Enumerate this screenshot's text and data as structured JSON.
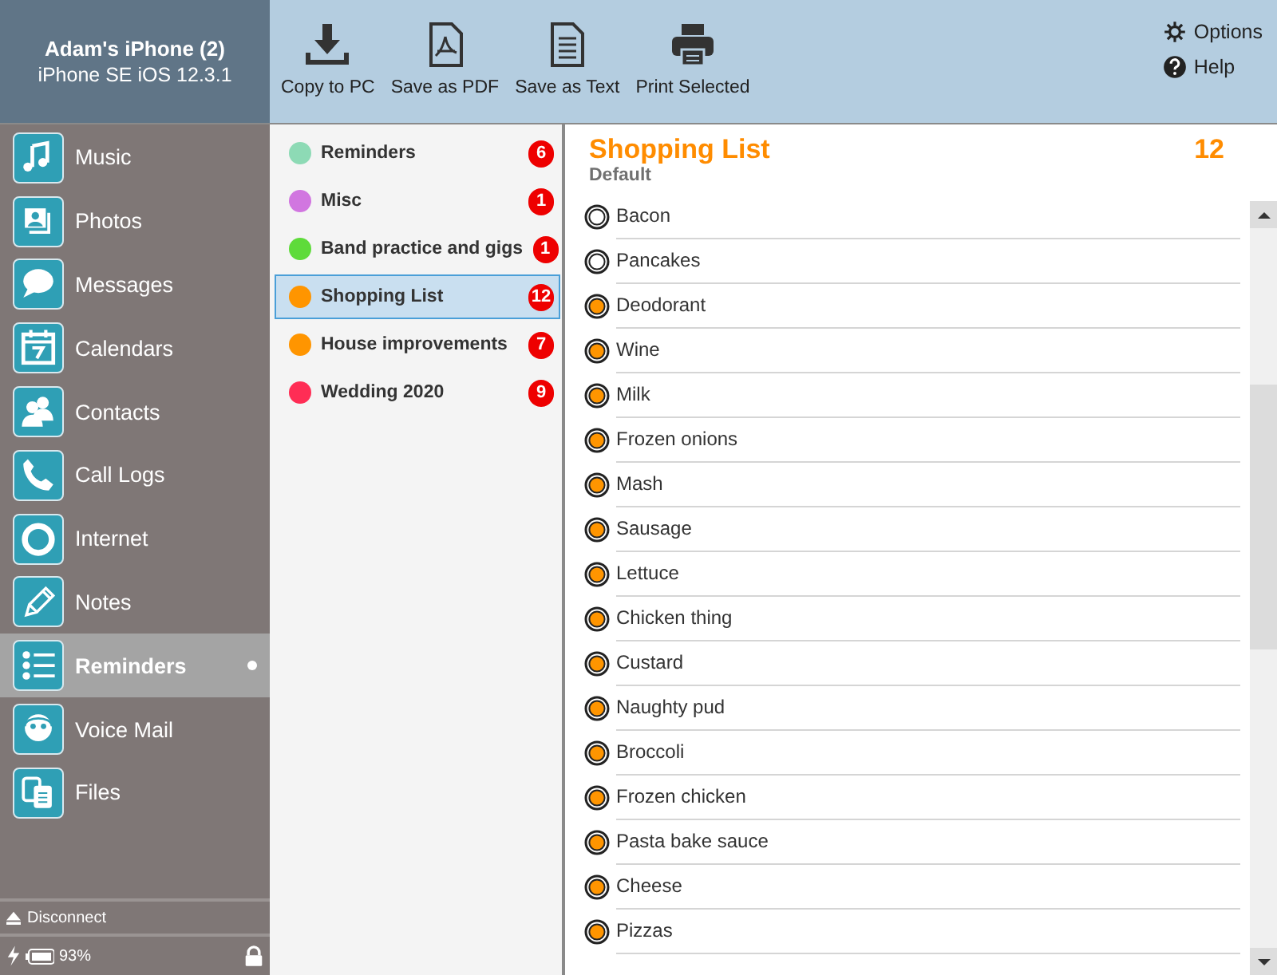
{
  "device": {
    "name": "Adam's iPhone (2)",
    "model": "iPhone SE iOS 12.3.1"
  },
  "toolbar": [
    {
      "kind": "download",
      "label": "Copy to PC"
    },
    {
      "kind": "pdf",
      "label": "Save as PDF"
    },
    {
      "kind": "text",
      "label": "Save as Text"
    },
    {
      "kind": "print",
      "label": "Print Selected"
    }
  ],
  "options": [
    {
      "kind": "gear",
      "label": "Options"
    },
    {
      "kind": "help",
      "label": "Help"
    }
  ],
  "sidebar": {
    "items": [
      {
        "kind": "music",
        "label": "Music",
        "selected": false
      },
      {
        "kind": "photos",
        "label": "Photos",
        "selected": false
      },
      {
        "kind": "messages",
        "label": "Messages",
        "selected": false
      },
      {
        "kind": "calendars",
        "label": "Calendars",
        "selected": false
      },
      {
        "kind": "contacts",
        "label": "Contacts",
        "selected": false
      },
      {
        "kind": "calls",
        "label": "Call Logs",
        "selected": false
      },
      {
        "kind": "internet",
        "label": "Internet",
        "selected": false
      },
      {
        "kind": "notes",
        "label": "Notes",
        "selected": false
      },
      {
        "kind": "reminders",
        "label": "Reminders",
        "selected": true
      },
      {
        "kind": "voicemail",
        "label": "Voice Mail",
        "selected": false
      },
      {
        "kind": "files",
        "label": "Files",
        "selected": false
      }
    ],
    "disconnect": "Disconnect",
    "battery": "93%"
  },
  "lists": [
    {
      "name": "Reminders",
      "count": "6",
      "color": "#8ddab5",
      "selected": false
    },
    {
      "name": "Misc",
      "count": "1",
      "color": "#d176e0",
      "selected": false
    },
    {
      "name": "Band practice and gigs",
      "count": "1",
      "color": "#5edb3a",
      "selected": false
    },
    {
      "name": "Shopping List",
      "count": "12",
      "color": "#ff9500",
      "selected": true
    },
    {
      "name": "House improvements",
      "count": "7",
      "color": "#ff9500",
      "selected": false
    },
    {
      "name": "Wedding 2020",
      "count": "9",
      "color": "#ff2d55",
      "selected": false
    }
  ],
  "detail": {
    "title": "Shopping List",
    "count": "12",
    "subtitle": "Default",
    "items": [
      {
        "text": "Bacon",
        "marked": false
      },
      {
        "text": "Pancakes",
        "marked": false
      },
      {
        "text": "Deodorant",
        "marked": true
      },
      {
        "text": "Wine",
        "marked": true
      },
      {
        "text": "Milk",
        "marked": true
      },
      {
        "text": "Frozen onions",
        "marked": true
      },
      {
        "text": "Mash",
        "marked": true
      },
      {
        "text": "Sausage",
        "marked": true
      },
      {
        "text": "Lettuce",
        "marked": true
      },
      {
        "text": "Chicken thing",
        "marked": true
      },
      {
        "text": "Custard",
        "marked": true
      },
      {
        "text": "Naughty pud",
        "marked": true
      },
      {
        "text": "Broccoli",
        "marked": true
      },
      {
        "text": "Frozen chicken",
        "marked": true
      },
      {
        "text": "Pasta bake sauce",
        "marked": true
      },
      {
        "text": "Cheese",
        "marked": true
      },
      {
        "text": "Pizzas",
        "marked": true
      }
    ]
  }
}
